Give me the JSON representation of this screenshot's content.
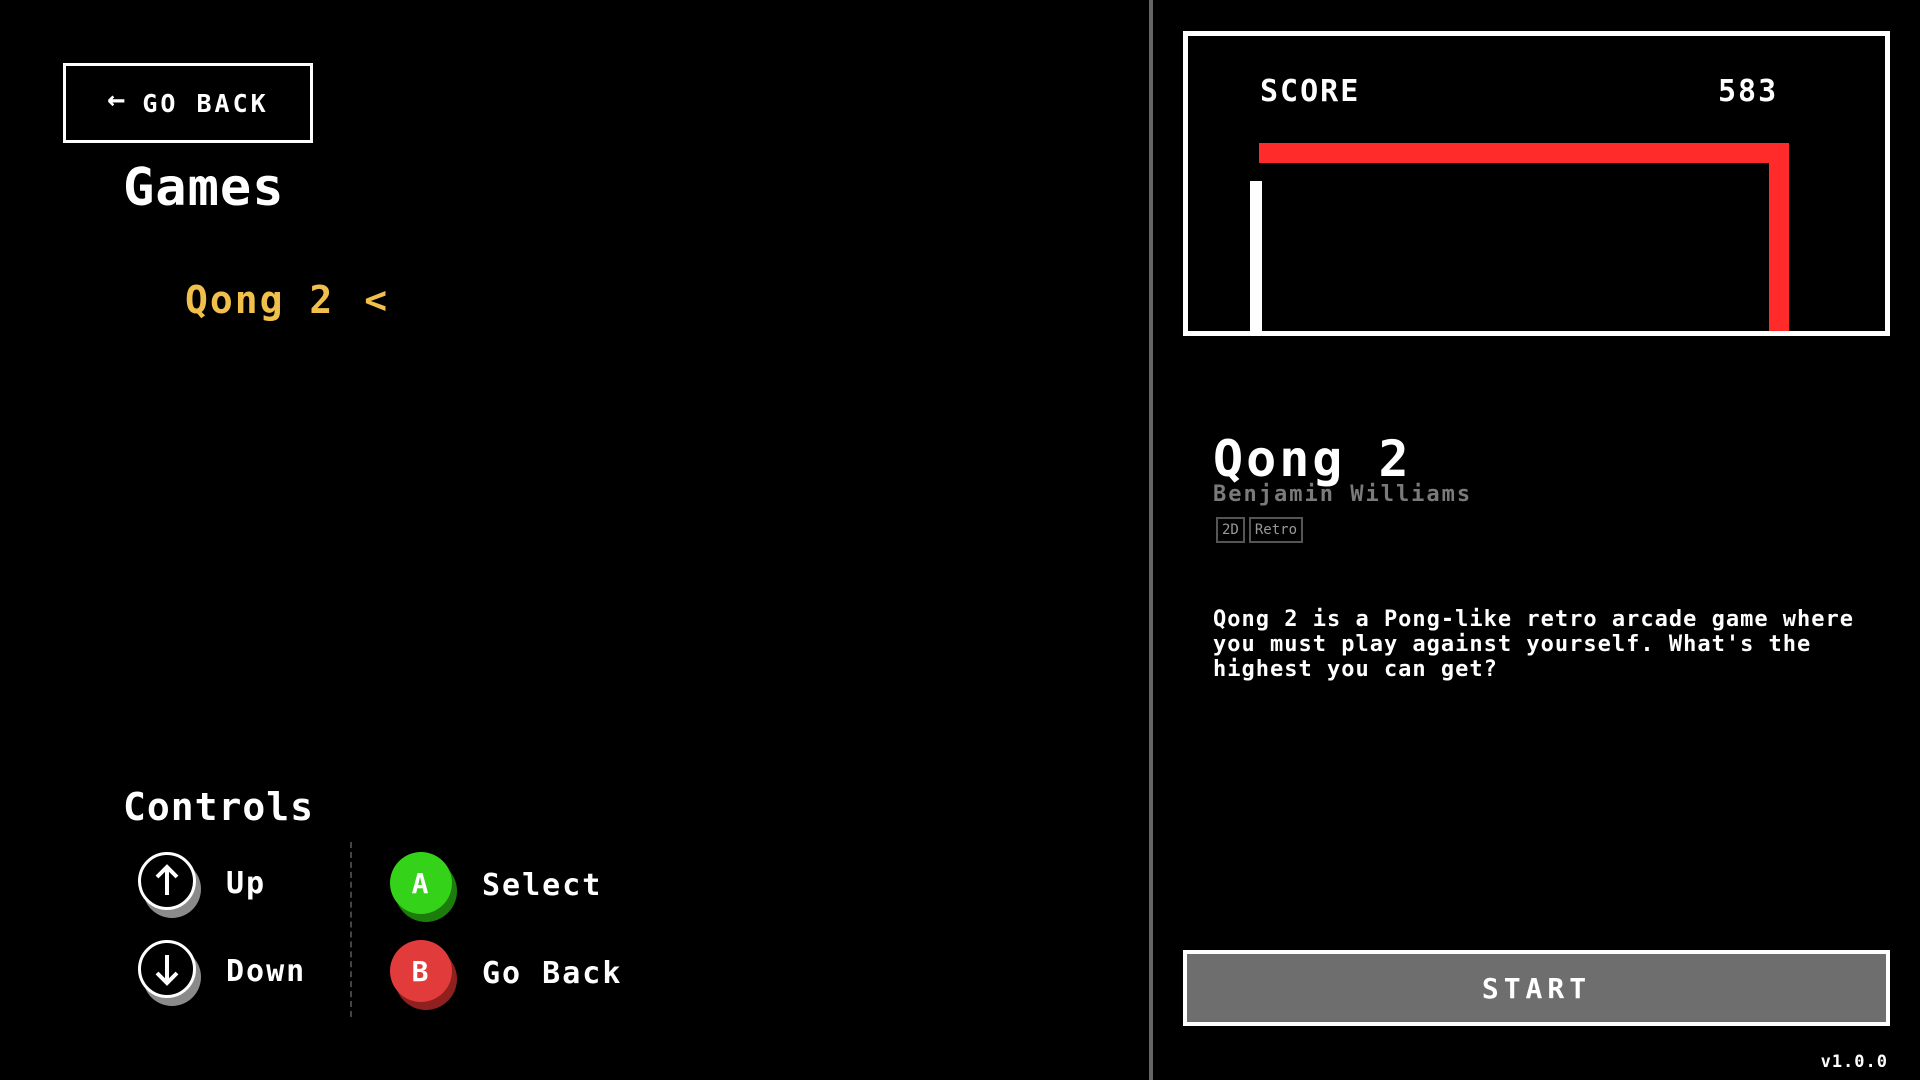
{
  "header": {
    "back_label": "GO BACK",
    "title": "Games"
  },
  "games": [
    {
      "name": "Qong 2",
      "selected_marker": "<"
    }
  ],
  "controls": {
    "title": "Controls",
    "up_label": "Up",
    "down_label": "Down",
    "a_key": "A",
    "a_label": "Select",
    "b_key": "B",
    "b_label": "Go Back"
  },
  "preview": {
    "score_label": "SCORE",
    "score_value": "583"
  },
  "details": {
    "name": "Qong 2",
    "author": "Benjamin Williams",
    "tags": [
      "2D",
      "Retro"
    ],
    "description": "Qong 2 is a Pong-like retro arcade game where you must play against yourself. What's the highest you can get?"
  },
  "start_label": "START",
  "version": "v1.0.0",
  "colors": {
    "selected_game": "#f1c04b",
    "paddle_red": "#ff2a2a",
    "button_a": "#35d21a",
    "button_b": "#e23b3b",
    "start_bg": "#6e6e6e"
  }
}
